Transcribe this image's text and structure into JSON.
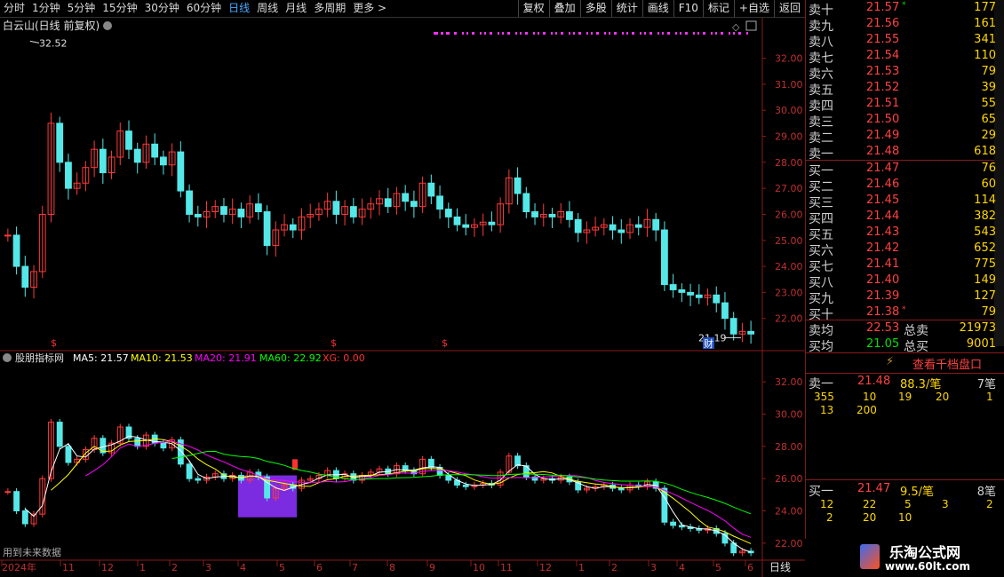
{
  "toolbar": {
    "periods": [
      "分时",
      "1分钟",
      "5分钟",
      "15分钟",
      "30分钟",
      "60分钟",
      "日线",
      "周线",
      "月线",
      "多周期",
      "更多 >"
    ],
    "active_period": "日线",
    "buttons": [
      "复权",
      "叠加",
      "多股",
      "统计",
      "画线",
      "F10",
      "标记",
      "+自选",
      "返回"
    ]
  },
  "main_chart": {
    "title": "白云山(日线 前复权)",
    "high_label": "32.52",
    "low_label": "21.19",
    "cai_label": "财",
    "y_ticks": [
      "32.00",
      "31.00",
      "30.00",
      "29.00",
      "28.00",
      "27.00",
      "26.00",
      "25.00",
      "24.00",
      "23.00",
      "22.00"
    ],
    "s_markers": [
      "$",
      "$",
      "$"
    ]
  },
  "indicator": {
    "name": "股朋指标网",
    "ma5": "MA5: 21.57",
    "ma10": "MA10: 21.53",
    "ma20": "MA20: 21.91",
    "ma60": "MA60: 22.92",
    "xg": "XG: 0.00",
    "y_ticks": [
      "32.00",
      "30.00",
      "28.00",
      "26.00",
      "24.00",
      "22.00"
    ],
    "footnote": "用到未来数据",
    "colors": {
      "ma5": "#ffffff",
      "ma10": "#ffff00",
      "ma20": "#ff00ff",
      "ma60": "#00ff00",
      "xg": "#ff3030",
      "box": "#7b2be0"
    }
  },
  "x_axis": {
    "labels": [
      "2024年",
      "11",
      "12",
      "1",
      "2",
      "3",
      "4",
      "5",
      "6",
      "7",
      "8",
      "9",
      "10",
      "11",
      "12",
      "1",
      "2",
      "3",
      "4",
      "5",
      "6"
    ],
    "period_tag": "日线"
  },
  "chart_data": {
    "type": "candlestick",
    "title": "白云山(日线 前复权)",
    "y_range": [
      21.0,
      32.6
    ],
    "close_series": [
      25.2,
      24.0,
      23.2,
      23.8,
      26.0,
      29.5,
      28.0,
      27.0,
      27.2,
      27.8,
      28.5,
      27.6,
      28.2,
      29.2,
      28.5,
      28.0,
      28.7,
      28.2,
      27.9,
      28.4,
      26.9,
      26.0,
      25.9,
      26.1,
      26.3,
      26.0,
      26.2,
      25.9,
      26.4,
      26.1,
      24.8,
      25.4,
      25.6,
      25.4,
      25.9,
      26.0,
      26.2,
      26.5,
      26.0,
      26.3,
      25.9,
      26.2,
      26.4,
      26.6,
      26.3,
      26.8,
      26.5,
      26.3,
      27.2,
      26.7,
      26.2,
      25.9,
      25.6,
      25.5,
      25.6,
      25.7,
      25.6,
      26.4,
      27.4,
      26.8,
      26.1,
      25.9,
      26.0,
      25.9,
      26.1,
      25.8,
      25.3,
      25.4,
      25.5,
      25.6,
      25.4,
      25.3,
      25.6,
      25.5,
      25.8,
      25.4,
      23.3,
      23.1,
      23.0,
      22.9,
      22.8,
      22.9,
      22.6,
      22.0,
      21.4,
      21.5,
      21.4
    ],
    "last_prices": {
      "ma5": 21.57,
      "ma10": 21.53,
      "ma20": 21.91,
      "ma60": 22.92
    }
  },
  "order_book": {
    "sells": [
      {
        "label": "卖十",
        "price": "21.57",
        "vol": "177",
        "flag": "*"
      },
      {
        "label": "卖九",
        "price": "21.56",
        "vol": "161",
        "flag": ""
      },
      {
        "label": "卖八",
        "price": "21.55",
        "vol": "341",
        "flag": ""
      },
      {
        "label": "卖七",
        "price": "21.54",
        "vol": "110",
        "flag": ""
      },
      {
        "label": "卖六",
        "price": "21.53",
        "vol": "79",
        "flag": ""
      },
      {
        "label": "卖五",
        "price": "21.52",
        "vol": "39",
        "flag": ""
      },
      {
        "label": "卖四",
        "price": "21.51",
        "vol": "55",
        "flag": ""
      },
      {
        "label": "卖三",
        "price": "21.50",
        "vol": "65",
        "flag": ""
      },
      {
        "label": "卖二",
        "price": "21.49",
        "vol": "29",
        "flag": ""
      },
      {
        "label": "卖一",
        "price": "21.48",
        "vol": "618",
        "flag": ""
      }
    ],
    "buys": [
      {
        "label": "买一",
        "price": "21.47",
        "vol": "76",
        "flag": ""
      },
      {
        "label": "买二",
        "price": "21.46",
        "vol": "60",
        "flag": ""
      },
      {
        "label": "买三",
        "price": "21.45",
        "vol": "114",
        "flag": ""
      },
      {
        "label": "买四",
        "price": "21.44",
        "vol": "382",
        "flag": ""
      },
      {
        "label": "买五",
        "price": "21.43",
        "vol": "543",
        "flag": ""
      },
      {
        "label": "买六",
        "price": "21.42",
        "vol": "652",
        "flag": ""
      },
      {
        "label": "买七",
        "price": "21.41",
        "vol": "775",
        "flag": ""
      },
      {
        "label": "买八",
        "price": "21.40",
        "vol": "149",
        "flag": ""
      },
      {
        "label": "买九",
        "price": "21.39",
        "vol": "127",
        "flag": ""
      },
      {
        "label": "买十",
        "price": "21.38",
        "vol": "79",
        "flag": "*"
      }
    ],
    "avg_sell": {
      "label": "卖均",
      "price": "22.53",
      "total_label": "总卖",
      "total": "21973"
    },
    "avg_buy": {
      "label": "买均",
      "price": "21.05",
      "total_label": "总买",
      "total": "9001"
    },
    "view_thousand": "查看千档盘口",
    "sell_one": {
      "label": "卖一",
      "price": "21.48",
      "per": "88.3/笔",
      "count": "7笔",
      "orders": [
        "355",
        "10",
        "19",
        "20",
        "1",
        "13",
        "200"
      ]
    },
    "buy_one": {
      "label": "买一",
      "price": "21.47",
      "per": "9.5/笔",
      "count": "8笔",
      "orders": [
        "12",
        "22",
        "5",
        "3",
        "2",
        "2",
        "20",
        "10"
      ]
    }
  },
  "logo": {
    "name": "乐淘公式网",
    "url": "www.60lt.com"
  }
}
